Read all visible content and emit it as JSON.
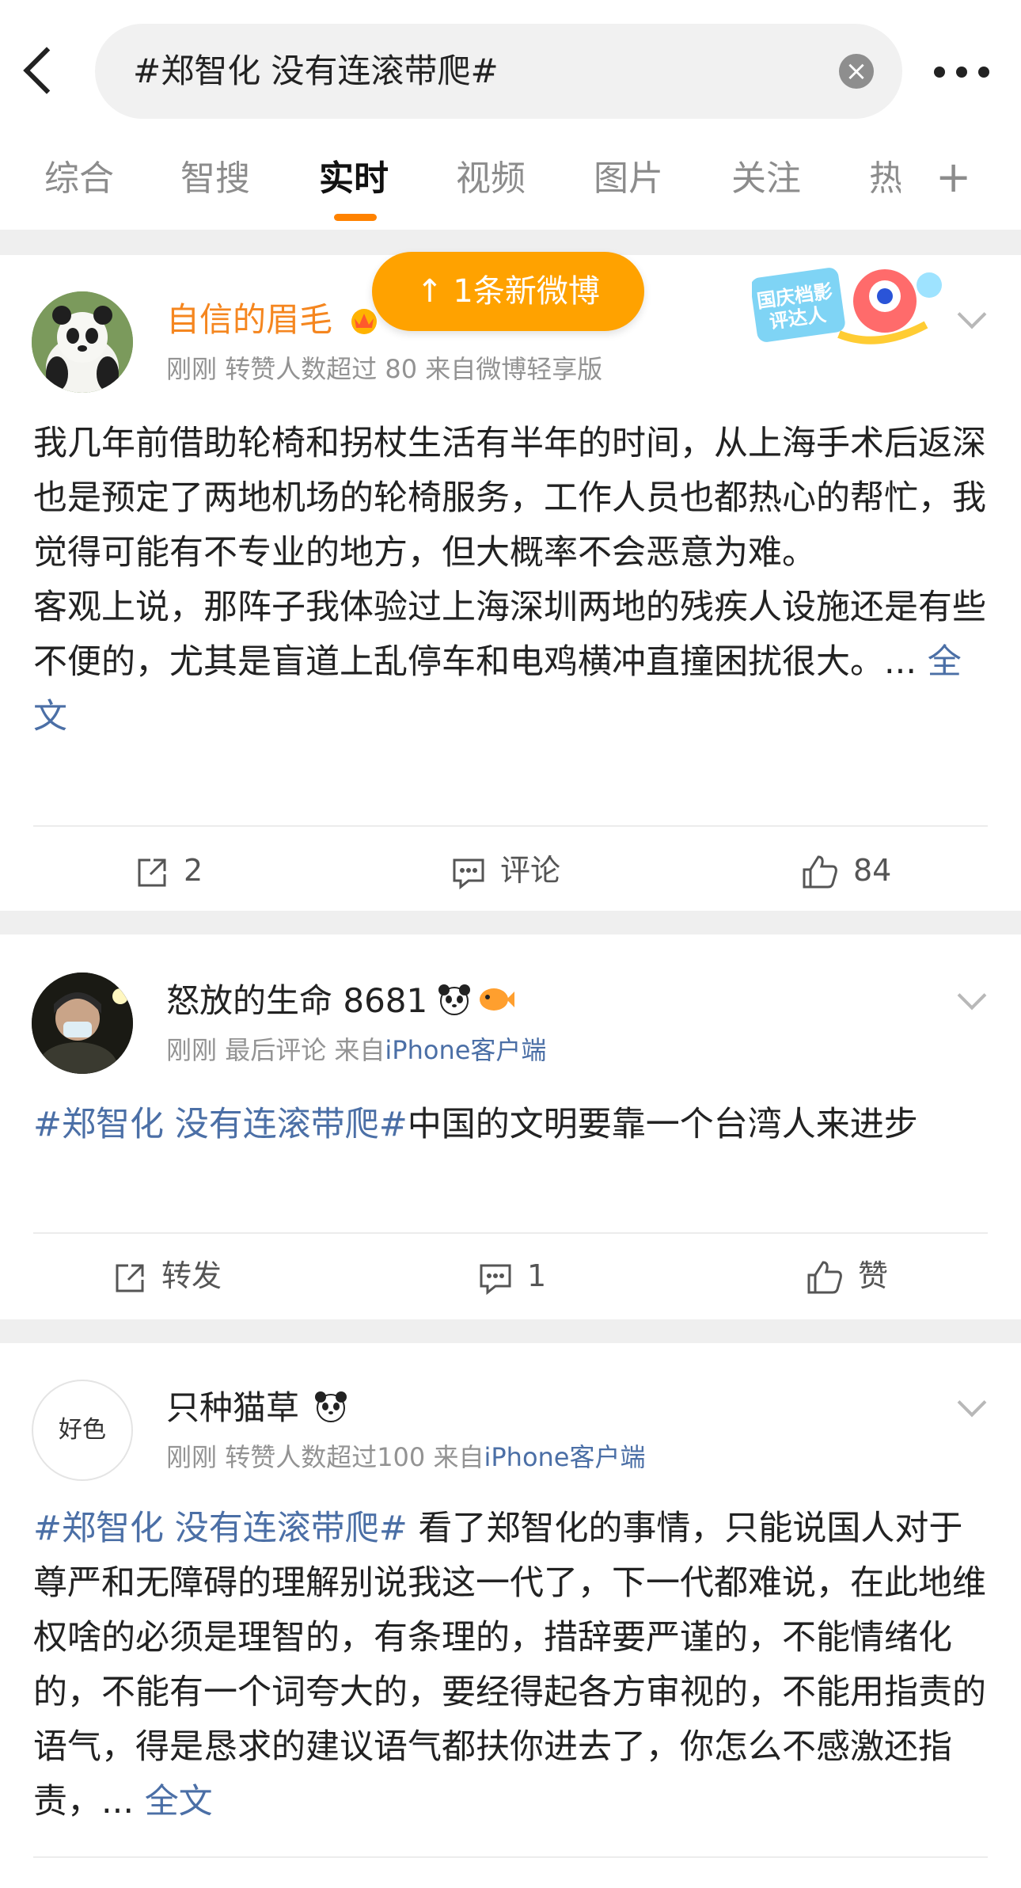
{
  "search": {
    "query": "#郑智化 没有连滚带爬#"
  },
  "tabs": [
    "综合",
    "智搜",
    "实时",
    "视频",
    "图片",
    "关注",
    "热"
  ],
  "active_tab": "实时",
  "toast": {
    "label": "↑ 1条新微博"
  },
  "badge": {
    "text": "国庆档影评达人"
  },
  "posts": [
    {
      "author": "自信的眉毛",
      "time": "刚刚",
      "stat": "转赞人数超过 80",
      "source_prefix": "来自",
      "source": "微博轻享版",
      "paragraphs": [
        "我几年前借助轮椅和拐杖生活有半年的时间，从上海手术后返深也是预定了两地机场的轮椅服务，工作人员也都热心的帮忙，我觉得可能有不专业的地方，但大概率不会恶意为难。",
        "客观上说，那阵子我体验过上海深圳两地的残疾人设施还是有些不便的，尤其是盲道上乱停车和电鸡横冲直撞困扰很大。..."
      ],
      "more_link": "全文",
      "repost": "2",
      "comment": "评论",
      "like": "84"
    },
    {
      "author": "怒放的生命 8681",
      "time": "刚刚",
      "stat": "最后评论",
      "source_prefix": "来自",
      "source": "iPhone客户端",
      "hashtag": "#郑智化 没有连滚带爬#",
      "text": "中国的文明要靠一个台湾人来进步",
      "repost": "转发",
      "comment": "1",
      "like": "赞"
    },
    {
      "author": "只种猫草",
      "avatar_text": "好色",
      "time": "刚刚",
      "stat": "转赞人数超过100",
      "source_prefix": "来自",
      "source": "iPhone客户端",
      "hashtag": "#郑智化 没有连滚带爬#",
      "text": " 看了郑智化的事情，只能说国人对于尊严和无障碍的理解别说我这一代了，下一代都难说，在此地维权啥的必须是理智的，有条理的，措辞要严谨的，不能情绪化的，不能有一个词夸大的，要经得起各方审视的，不能用指责的语气，得是恳求的建议语气都扶你进去了，你怎么不感激还指责，...",
      "more_link": "全文"
    }
  ],
  "colors": {
    "accent": "#ff8200",
    "link": "#4b6fa6",
    "author_vip": "#f5861f"
  }
}
